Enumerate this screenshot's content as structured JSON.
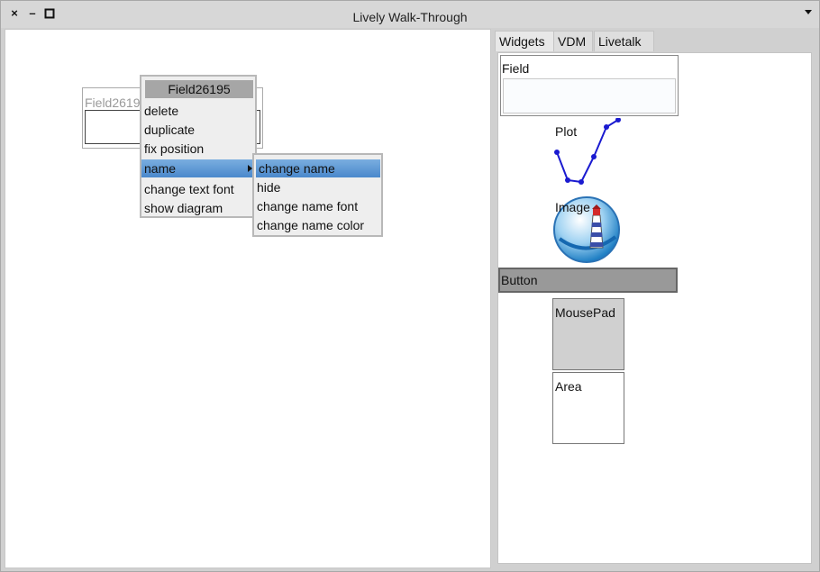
{
  "window": {
    "title": "Lively Walk-Through",
    "close_glyph": "×",
    "minimize_glyph": "–",
    "maximize_glyph": "□",
    "menu_icon": "chevron-down-icon"
  },
  "canvas": {
    "field": {
      "name": "Field26195"
    }
  },
  "context_menu": {
    "title": "Field26195",
    "items": [
      {
        "label": "delete"
      },
      {
        "label": "duplicate"
      },
      {
        "label": "fix position"
      },
      {
        "label": "name"
      },
      {
        "label": "change text font"
      },
      {
        "label": "show diagram"
      }
    ]
  },
  "submenu": {
    "items": [
      {
        "label": "change name"
      },
      {
        "label": "hide"
      },
      {
        "label": "change name font"
      },
      {
        "label": "change name color"
      }
    ]
  },
  "tabs": [
    {
      "label": "Widgets"
    },
    {
      "label": "VDM"
    },
    {
      "label": "Livetalk"
    }
  ],
  "widgets": {
    "field": "Field",
    "plot": "Plot",
    "image": "Image",
    "button": "Button",
    "mousepad": "MousePad",
    "area": "Area"
  },
  "colors": {
    "highlight": "#5a95d6",
    "plot_line": "#1a1ad0"
  }
}
